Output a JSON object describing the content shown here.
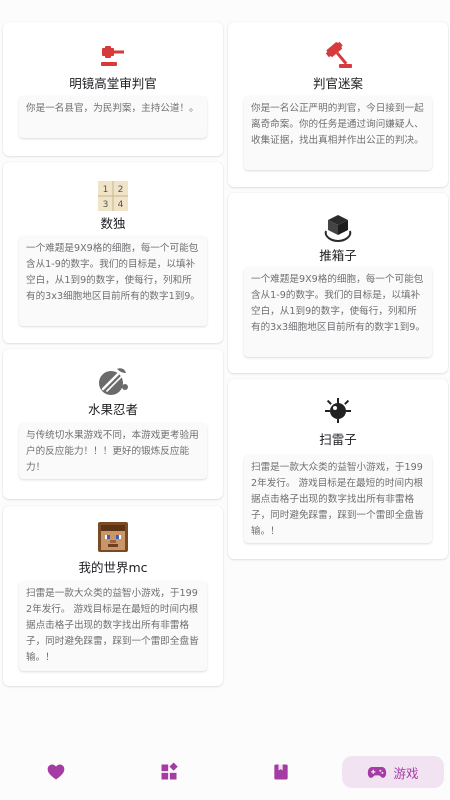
{
  "games": {
    "judge": {
      "title": "明镜高堂审判官",
      "desc": "你是一名县官，为民判案，主持公道！。",
      "icon": "gavel-icon",
      "icon_color": "#d63a3a"
    },
    "mystery": {
      "title": "判官迷案",
      "desc": "你是一名公正严明的判官，今日接到一起离奇命案。你的任务是通过询问嫌疑人、收集证据，找出真相并作出公正的判决。",
      "icon": "judge-hammer-icon",
      "icon_color": "#d63a3a"
    },
    "sudoku": {
      "title": "数独",
      "desc": "一个难题是9X9格的细胞，每一个可能包含从1-9的数字。我们的目标是，以填补空白，从1到9的数字，使每行，列和所有的3x3细胞地区目前所有的数字1到9。",
      "icon": "sudoku-grid-icon",
      "icon_digits": [
        "1",
        "2",
        "3",
        "4"
      ]
    },
    "sokoban": {
      "title": "推箱子",
      "desc": "一个难题是9X9格的细胞，每一个可能包含从1-9的数字。我们的目标是，以填补空白，从1到9的数字，使每行，列和所有的3x3细胞地区目前所有的数字1到9。",
      "icon": "box-push-icon"
    },
    "fruit": {
      "title": "水果忍者",
      "desc": "与传统切水果游戏不同，本游戏更考验用户的反应能力！！！更好的锻炼反应能力！",
      "icon": "fruit-slice-icon"
    },
    "minesweeper": {
      "title": "扫雷子",
      "desc": "扫雷是一款大众类的益智小游戏，于1992年发行。 游戏目标是在最短的时间内根据点击格子出现的数字找出所有非雷格子，同时避免踩雷，踩到一个雷即全盘皆输。！",
      "icon": "mine-icon"
    },
    "minecraft": {
      "title": "我的世界mc",
      "desc": "扫雷是一款大众类的益智小游戏，于1992年发行。 游戏目标是在最短的时间内根据点击格子出现的数字找出所有非雷格子，同时避免踩雷，踩到一个雷即全盘皆输。！",
      "icon": "steve-face-icon"
    }
  },
  "nav": {
    "items": [
      {
        "id": "favorites",
        "icon": "heart-icon",
        "label": ""
      },
      {
        "id": "apps",
        "icon": "widgets-icon",
        "label": ""
      },
      {
        "id": "book",
        "icon": "book-icon",
        "label": ""
      },
      {
        "id": "games",
        "icon": "gamepad-icon",
        "label": "游戏",
        "active": true
      }
    ],
    "accent": "#a43ca3",
    "active_bg": "#f2e3f3"
  }
}
